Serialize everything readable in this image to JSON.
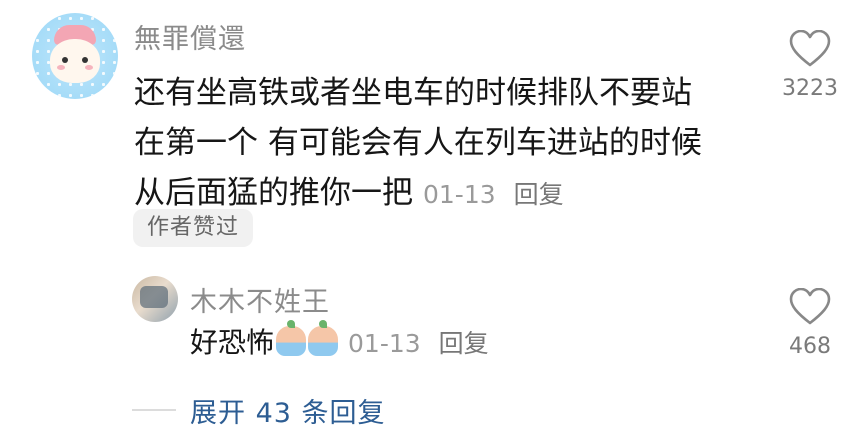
{
  "comment": {
    "username": "無罪償還",
    "lines": [
      "还有坐高铁或者坐电车的时候排队不要站",
      "在第一个 有可能会有人在列车进站的时候",
      "从后面猛的推你一把"
    ],
    "date": "01-13",
    "reply_label": "回复",
    "badge": "作者赞过",
    "like_count": "3223"
  },
  "reply": {
    "username": "木木不姓王",
    "text": "好恐怖",
    "emoji_icons": [
      "crying-peach-emoji-icon",
      "crying-peach-emoji-icon"
    ],
    "date": "01-13",
    "reply_label": "回复",
    "like_count": "468"
  },
  "expand_replies": "展开 43 条回复"
}
